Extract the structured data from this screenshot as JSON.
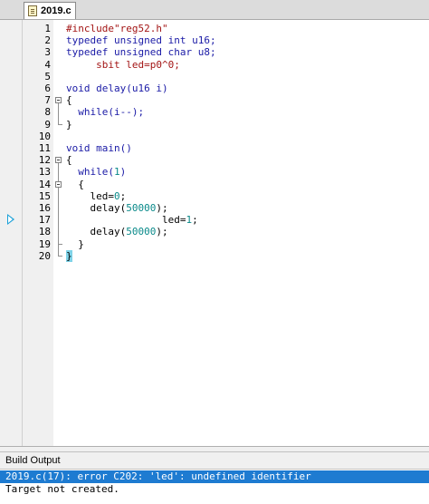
{
  "tab": {
    "label": "2019.c",
    "icon": "file-c-icon"
  },
  "editor": {
    "line_numbers": [
      "1",
      "2",
      "3",
      "4",
      "5",
      "6",
      "7",
      "8",
      "9",
      "10",
      "11",
      "12",
      "13",
      "14",
      "15",
      "16",
      "17",
      "18",
      "19",
      "20"
    ],
    "execution_arrow_line": 17,
    "highlighted_line": 20,
    "lines": [
      [
        {
          "t": "#include\"reg52.h\"",
          "c": "str"
        }
      ],
      [
        {
          "t": "typedef unsigned int u16;",
          "c": "kw"
        }
      ],
      [
        {
          "t": "typedef unsigned char u8;",
          "c": "kw"
        }
      ],
      [
        {
          "t": "     sbit led=p0^0;",
          "c": "str"
        }
      ],
      [],
      [
        {
          "t": "void delay(u16 i)",
          "c": "kw"
        }
      ],
      [
        {
          "t": "{",
          "c": ""
        }
      ],
      [
        {
          "t": "  while(i--);",
          "c": "kw"
        }
      ],
      [
        {
          "t": "}",
          "c": ""
        }
      ],
      [],
      [
        {
          "t": "void main()",
          "c": "kw"
        }
      ],
      [
        {
          "t": "{",
          "c": "brace"
        }
      ],
      [
        {
          "t": "  while(",
          "c": "kw"
        },
        {
          "t": "1",
          "c": "num"
        },
        {
          "t": ")",
          "c": "kw"
        }
      ],
      [
        {
          "t": "  {",
          "c": ""
        }
      ],
      [
        {
          "t": "    led=",
          "c": ""
        },
        {
          "t": "0",
          "c": "num"
        },
        {
          "t": ";",
          "c": ""
        }
      ],
      [
        {
          "t": "    delay(",
          "c": ""
        },
        {
          "t": "50000",
          "c": "num"
        },
        {
          "t": ");",
          "c": ""
        }
      ],
      [
        {
          "t": "                led=",
          "c": ""
        },
        {
          "t": "1",
          "c": "num"
        },
        {
          "t": ";",
          "c": ""
        }
      ],
      [
        {
          "t": "    delay(",
          "c": ""
        },
        {
          "t": "50000",
          "c": "num"
        },
        {
          "t": ");",
          "c": ""
        }
      ],
      [
        {
          "t": "  }",
          "c": ""
        }
      ],
      [
        {
          "t": "}",
          "c": "brace"
        }
      ]
    ]
  },
  "build_output": {
    "title": "Build Output",
    "lines": [
      "2019.c(17): error C202: 'led': undefined identifier",
      "Target not created."
    ]
  }
}
